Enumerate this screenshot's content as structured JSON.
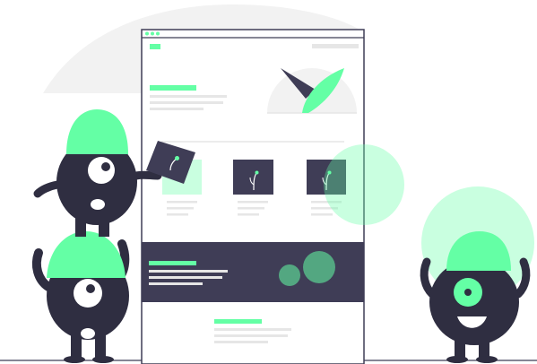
{
  "illustration": {
    "subject": "website-wireframe-with-monsters",
    "colors": {
      "accent": "#64FFA5",
      "accent_soft": "#C9FFE0",
      "dark": "#3F3D56",
      "monster": "#2F2E41",
      "light_gray": "#F2F2F2",
      "mid_gray": "#E6E6E6",
      "line_gray": "#E0E0E0",
      "white": "#FFFFFF"
    },
    "icons": [
      "window-frame-icon",
      "gauge-icon",
      "leaf-icon",
      "monster-icon",
      "decorative-circle-icon"
    ],
    "texts": []
  }
}
